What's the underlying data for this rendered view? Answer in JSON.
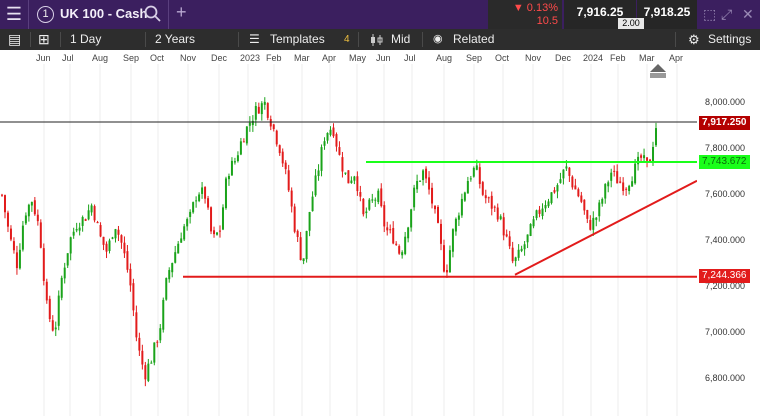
{
  "topbar": {
    "menu_icon": "menu-icon",
    "instrument_number": "1",
    "instrument_name": "UK 100 - Cash",
    "change_pct": "▼ 0.13%",
    "change_pts": "10.5",
    "sell_price": "7,916.25",
    "buy_price": "7,918.25",
    "spread": "2.00",
    "colors": {
      "bar": "#3b1f5f",
      "down": "#ff4a4a"
    }
  },
  "toolbar": {
    "interval": "1 Day",
    "range": "2 Years",
    "templates": "Templates",
    "templates_count": "4",
    "price_type": "Mid",
    "related": "Related",
    "settings": "Settings"
  },
  "chart_data": {
    "type": "candlestick",
    "x_labels": [
      "Jun",
      "Jul",
      "Aug",
      "Sep",
      "Oct",
      "Nov",
      "Dec",
      "2023",
      "Feb",
      "Mar",
      "Apr",
      "May",
      "Jun",
      "Jul",
      "Aug",
      "Sep",
      "Oct",
      "Nov",
      "Dec",
      "2024",
      "Feb",
      "Mar",
      "Apr"
    ],
    "y_ticks": [
      "8,000.000",
      "7,800.000",
      "7,600.000",
      "7,400.000",
      "7,200.000",
      "7,000.000",
      "6,800.000"
    ],
    "ylim": [
      6700,
      8080
    ],
    "close_path": [
      7600,
      7420,
      7300,
      7520,
      7580,
      7450,
      7100,
      7000,
      7250,
      7400,
      7480,
      7500,
      7560,
      7420,
      7350,
      7480,
      7380,
      7230,
      6950,
      6820,
      6900,
      7020,
      7250,
      7350,
      7450,
      7500,
      7620,
      7600,
      7400,
      7450,
      7700,
      7750,
      7850,
      7920,
      7980,
      8000,
      7900,
      7800,
      7650,
      7450,
      7300,
      7550,
      7700,
      7870,
      7900,
      7750,
      7660,
      7700,
      7500,
      7560,
      7600,
      7450,
      7420,
      7340,
      7480,
      7640,
      7700,
      7600,
      7450,
      7250,
      7440,
      7560,
      7670,
      7720,
      7600,
      7560,
      7520,
      7420,
      7300,
      7350,
      7420,
      7500,
      7560,
      7600,
      7650,
      7720,
      7640,
      7580,
      7460,
      7500,
      7600,
      7700,
      7660,
      7640,
      7700,
      7760,
      7720,
      7900
    ],
    "current_price": "7,917.250",
    "resistance": "7,743.672",
    "support": "7,244.366",
    "colors": {
      "up": "#1aa31a",
      "down": "#e21b1b",
      "resistance": "#1aff1a",
      "support": "#e21b1b",
      "trend": "#e21b1b"
    }
  }
}
